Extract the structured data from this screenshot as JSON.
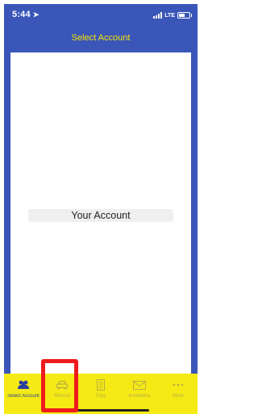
{
  "status_bar": {
    "time": "5:44",
    "location_arrow": "➤",
    "network": "LTE",
    "battery_level": 0.6
  },
  "nav": {
    "title": "Select Account"
  },
  "content": {
    "account_label": "Your Account"
  },
  "tabs": [
    {
      "label": "Select Account",
      "icon": "users-icon",
      "active": true
    },
    {
      "label": "Record",
      "icon": "car-icon",
      "active": false
    },
    {
      "label": "Trips",
      "icon": "document-icon",
      "active": false
    },
    {
      "label": "Invitations",
      "icon": "envelope-icon",
      "active": false
    },
    {
      "label": "More",
      "icon": "more-icon",
      "active": false
    }
  ],
  "colors": {
    "app_blue": "#3a56b8",
    "title_yellow": "#f5e400",
    "tab_bar_yellow": "#f5ea14",
    "active_tab": "#2a3f9c",
    "inactive_tab": "#b9ad46",
    "highlight_red": "#ee1c1c"
  }
}
